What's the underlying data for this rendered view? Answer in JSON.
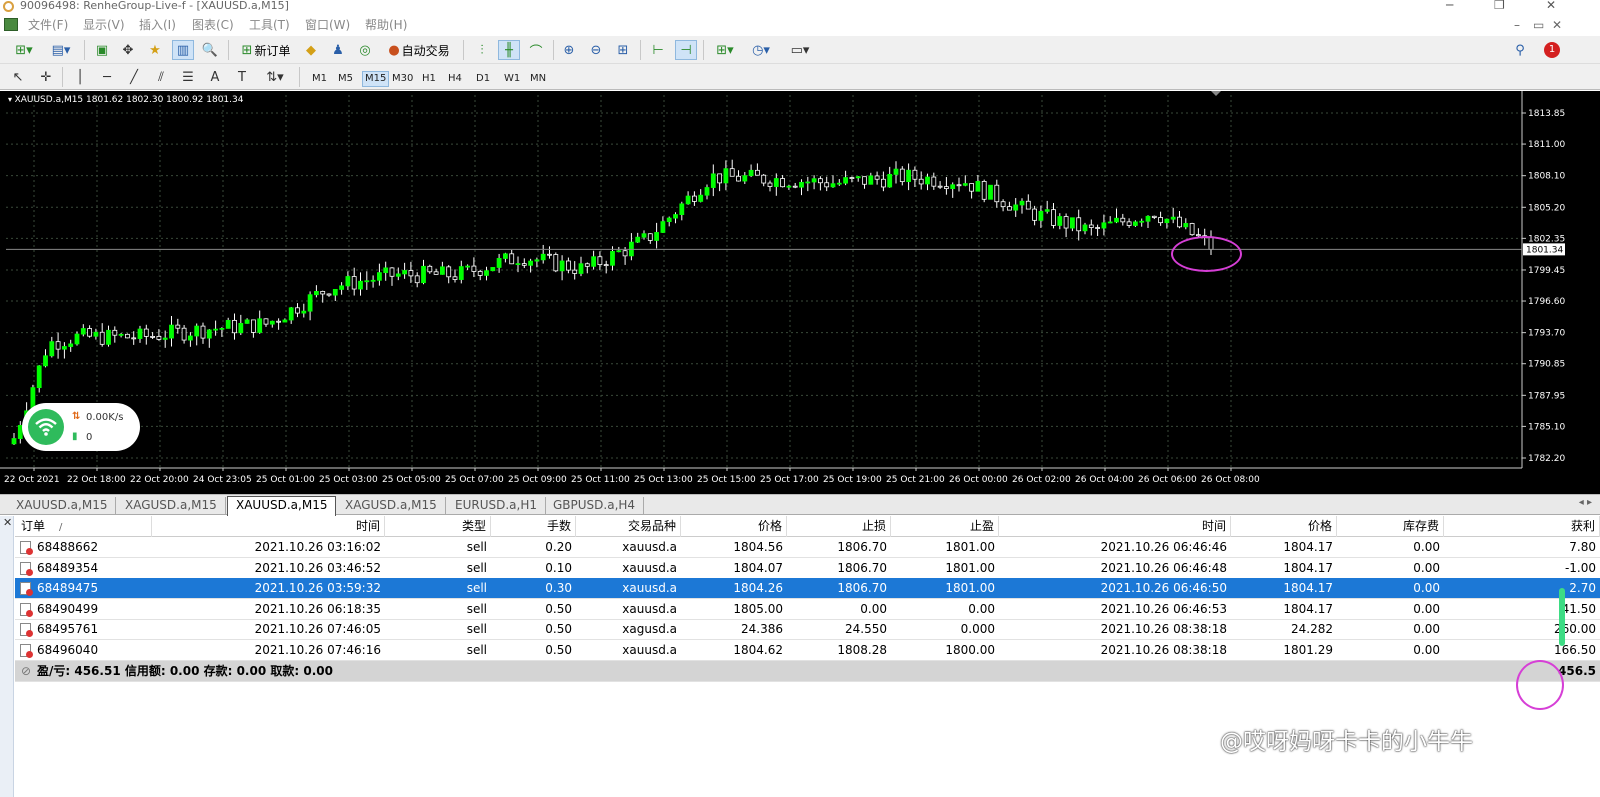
{
  "window": {
    "title": "90096498: RenheGroup-Live-f - [XAUUSD.a,M15]"
  },
  "menu": [
    "文件(F)",
    "显示(V)",
    "插入(I)",
    "图表(C)",
    "工具(T)",
    "窗口(W)",
    "帮助(H)"
  ],
  "toolbar": {
    "new_order": "新订单",
    "auto_trading": "自动交易",
    "notification_count": "1"
  },
  "timeframes": [
    "M1",
    "M5",
    "M15",
    "M30",
    "H1",
    "H4",
    "D1",
    "W1",
    "MN"
  ],
  "selected_timeframe": "M15",
  "chart": {
    "info": "XAUUSD.a,M15  1801.62 1802.30 1800.92 1801.34",
    "current_price": "1801.34",
    "price_labels": [
      "1813.85",
      "1811.00",
      "1808.10",
      "1805.20",
      "1802.35",
      "1799.45",
      "1796.60",
      "1793.70",
      "1790.85",
      "1787.95",
      "1785.10",
      "1782.20"
    ],
    "time_labels": [
      "22 Oct 2021",
      "22 Oct 18:00",
      "22 Oct 20:00",
      "24 Oct 23:05",
      "25 Oct 01:00",
      "25 Oct 03:00",
      "25 Oct 05:00",
      "25 Oct 07:00",
      "25 Oct 09:00",
      "25 Oct 11:00",
      "25 Oct 13:00",
      "25 Oct 15:00",
      "25 Oct 17:00",
      "25 Oct 19:00",
      "25 Oct 21:00",
      "26 Oct 00:00",
      "26 Oct 02:00",
      "26 Oct 04:00",
      "26 Oct 06:00",
      "26 Oct 08:00"
    ],
    "colors": {
      "up": "#00ff00",
      "down": "#000000",
      "wick": "#ffffff",
      "bg": "#000000"
    }
  },
  "chart_data": {
    "type": "line",
    "title": "XAUUSD.a,M15",
    "x": [
      "22 Oct 2021",
      "22 Oct 18:00",
      "22 Oct 20:00",
      "24 Oct 23:05",
      "25 Oct 01:00",
      "25 Oct 03:00",
      "25 Oct 05:00",
      "25 Oct 07:00",
      "25 Oct 09:00",
      "25 Oct 11:00",
      "25 Oct 13:00",
      "25 Oct 15:00",
      "25 Oct 17:00",
      "25 Oct 19:00",
      "25 Oct 21:00",
      "26 Oct 00:00",
      "26 Oct 02:00",
      "26 Oct 04:00",
      "26 Oct 06:00",
      "26 Oct 08:00"
    ],
    "series": [
      {
        "values": [
          1792.0,
          1793.3,
          1793.3,
          1794.0,
          1794.5,
          1797.9,
          1799.0,
          1799.0,
          1800.7,
          1799.5,
          1802.3,
          1808.0,
          1807.8,
          1807.4,
          1808.0,
          1807.6,
          1804.8,
          1803.0,
          1804.8,
          1801.34
        ]
      }
    ],
    "ylim": [
      1782.2,
      1813.85
    ],
    "grid": true
  },
  "tabs": [
    "XAUUSD.a,M15",
    "XAGUSD.a,M15",
    "XAUUSD.a,M15",
    "XAGUSD.a,M15",
    "EURUSD.a,H1",
    "GBPUSD.a,H4"
  ],
  "active_tab": 2,
  "orders": {
    "headers": [
      "订单",
      "时间",
      "类型",
      "手数",
      "交易品种",
      "价格",
      "止损",
      "止盈",
      "时间",
      "价格",
      "库存费",
      "获利"
    ],
    "sort_indicator": "/",
    "rows": [
      [
        "68488662",
        "2021.10.26 03:16:02",
        "sell",
        "0.20",
        "xauusd.a",
        "1804.56",
        "1806.70",
        "1801.00",
        "2021.10.26 06:46:46",
        "1804.17",
        "0.00",
        "7.80"
      ],
      [
        "68489354",
        "2021.10.26 03:46:52",
        "sell",
        "0.10",
        "xauusd.a",
        "1804.07",
        "1806.70",
        "1801.00",
        "2021.10.26 06:46:48",
        "1804.17",
        "0.00",
        "-1.00"
      ],
      [
        "68489475",
        "2021.10.26 03:59:32",
        "sell",
        "0.30",
        "xauusd.a",
        "1804.26",
        "1806.70",
        "1801.00",
        "2021.10.26 06:46:50",
        "1804.17",
        "0.00",
        "2.70"
      ],
      [
        "68490499",
        "2021.10.26 06:18:35",
        "sell",
        "0.50",
        "xauusd.a",
        "1805.00",
        "0.00",
        "0.00",
        "2021.10.26 06:46:53",
        "1804.17",
        "0.00",
        "41.50"
      ],
      [
        "68495761",
        "2021.10.26 07:46:05",
        "sell",
        "0.50",
        "xagusd.a",
        "24.386",
        "24.550",
        "0.000",
        "2021.10.26 08:38:18",
        "24.282",
        "0.00",
        "260.00"
      ],
      [
        "68496040",
        "2021.10.26 07:46:16",
        "sell",
        "0.50",
        "xauusd.a",
        "1804.62",
        "1808.28",
        "1800.00",
        "2021.10.26 08:38:18",
        "1801.29",
        "0.00",
        "166.50"
      ]
    ],
    "selected_row": 2,
    "summary": "盈/亏: 456.51  信用额: 0.00  存款: 0.00  取款: 0.00",
    "total": "456.5"
  },
  "network_widget": {
    "speed": "0.00K/s",
    "count": "0"
  },
  "watermark": "@哎呀妈呀卡卡的小牛牛"
}
